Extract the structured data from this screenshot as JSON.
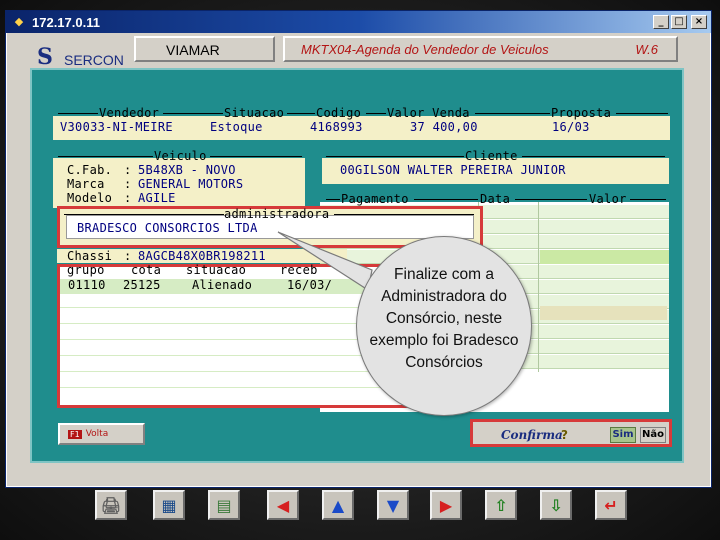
{
  "window": {
    "title": "172.17.0.11",
    "min_label": "_",
    "max_label": "□",
    "close_label": "×"
  },
  "header": {
    "logo": "S",
    "app_name": "SERCON",
    "company": "VIAMAR",
    "module_title": "MKTX04-Agenda do Vendedor de Veiculos",
    "version": "W.6"
  },
  "top_fields": {
    "labels": {
      "vendedor": "Vendedor",
      "situacao": "Situacao",
      "codigo": "Codigo",
      "valor_venda": "Valor Venda",
      "proposta": "Proposta"
    },
    "values": {
      "vendedor": "V30033-NI-MEIRE",
      "situacao": "Estoque",
      "codigo": "4168993",
      "valor_venda": "37 400,00",
      "proposta": "16/03"
    }
  },
  "vehicle": {
    "section_label": "Veiculo",
    "rows": [
      {
        "label": "C.Fab.",
        "sep": ":",
        "value": "5B48XB - NOVO"
      },
      {
        "label": "Marca",
        "sep": ":",
        "value": "GENERAL MOTORS"
      },
      {
        "label": "Modelo",
        "sep": ":",
        "value": "AGILE"
      }
    ],
    "chassi_label": "Chassi",
    "chassi_sep": ":",
    "chassi_value": "8AGCB48X0BR198211"
  },
  "client": {
    "section_label": "Cliente",
    "value": "00GILSON WALTER PEREIRA JUNIOR"
  },
  "payment": {
    "col_pagamento": "Pagamento",
    "col_data": "Data",
    "col_valor": "Valor"
  },
  "administradora": {
    "label": "administradora",
    "value": "BRADESCO CONSORCIOS LTDA"
  },
  "grupo_table": {
    "headers": [
      "grupo",
      "cota",
      "situacao",
      "receb"
    ],
    "rows": [
      {
        "grupo": "01110",
        "cota": "25125",
        "situacao": "Alienado",
        "receb": "16/03/"
      }
    ]
  },
  "footer": {
    "f1_key": "F1",
    "f1_label": "Volta",
    "confirm_label": "Confirma",
    "confirm_icon": "?",
    "yes_label": "Sim",
    "no_label": "Não"
  },
  "toolbar": {
    "buttons": [
      {
        "name": "print-icon",
        "glyph": "🖨",
        "color": "#606060"
      },
      {
        "name": "calculator-icon",
        "glyph": "▦",
        "color": "#1a4a8a"
      },
      {
        "name": "money-icon",
        "glyph": "▤",
        "color": "#3a7a3a"
      },
      {
        "name": "arrow-left-icon",
        "glyph": "◀",
        "color": "#d62020"
      },
      {
        "name": "arrow-up-icon",
        "glyph": "▲",
        "color": "#1a4ac8"
      },
      {
        "name": "arrow-down-icon",
        "glyph": "▼",
        "color": "#1a4ac8"
      },
      {
        "name": "arrow-right-icon",
        "glyph": "▶",
        "color": "#d62020"
      },
      {
        "name": "page-up-icon",
        "glyph": "⇧",
        "color": "#208020"
      },
      {
        "name": "page-down-icon",
        "glyph": "⇩",
        "color": "#208020"
      },
      {
        "name": "enter-icon",
        "glyph": "↵",
        "color": "#d62020"
      }
    ]
  },
  "callout": {
    "text": "Finalize com a Administradora do Consórcio, neste exemplo foi Bradesco Consórcios"
  }
}
